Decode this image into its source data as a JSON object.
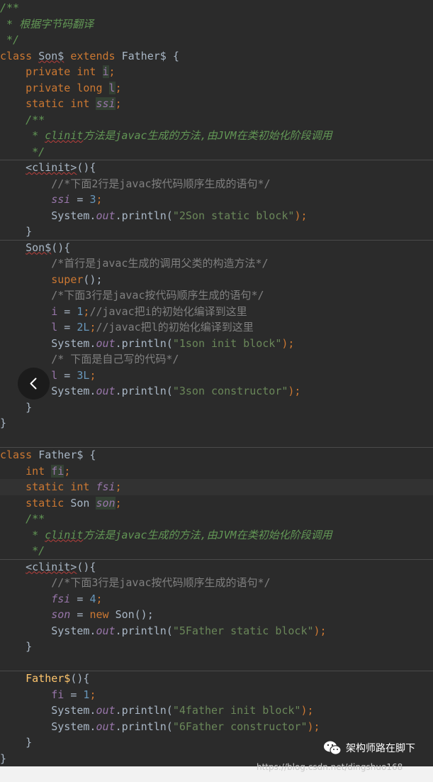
{
  "editor": {
    "lines": [
      [
        {
          "t": "/**",
          "c": "cmi"
        }
      ],
      [
        {
          "t": " * 根据字节码翻译",
          "c": "cmi"
        }
      ],
      [
        {
          "t": " */",
          "c": "cmi"
        }
      ],
      [
        {
          "t": "class ",
          "c": "kw"
        },
        {
          "t": "Son$",
          "c": "pl squig"
        },
        {
          "t": " extends ",
          "c": "kw"
        },
        {
          "t": "Father$ {",
          "c": "pl"
        }
      ],
      [
        {
          "t": "    private int ",
          "c": "kw"
        },
        {
          "t": "i",
          "c": "fd usage"
        },
        {
          "t": ";",
          "c": "kw"
        }
      ],
      [
        {
          "t": "    private long ",
          "c": "kw"
        },
        {
          "t": "l",
          "c": "fd usage"
        },
        {
          "t": ";",
          "c": "kw"
        }
      ],
      [
        {
          "t": "    static int ",
          "c": "kw"
        },
        {
          "t": "ssi",
          "c": "sf usage"
        },
        {
          "t": ";",
          "c": "kw"
        }
      ],
      [
        {
          "t": "    /**",
          "c": "cmi"
        }
      ],
      [
        {
          "t": "     * ",
          "c": "cmi"
        },
        {
          "t": "clinit",
          "c": "cmi squig"
        },
        {
          "t": "方法是javac生成的方法,由JVM在类初始化阶段调用",
          "c": "cmi"
        }
      ],
      [
        {
          "t": "     */",
          "c": "cmi"
        }
      ],
      [
        {
          "t": "    ",
          "c": "pl"
        },
        {
          "t": "<clinit>",
          "c": "pl squig"
        },
        {
          "t": "(){",
          "c": "pl"
        }
      ],
      [
        {
          "t": "        //*下面2行是javac按代码顺序生成的语句*/",
          "c": "cm"
        }
      ],
      [
        {
          "t": "        ",
          "c": "pl"
        },
        {
          "t": "ssi",
          "c": "sf"
        },
        {
          "t": " = ",
          "c": "pl"
        },
        {
          "t": "3",
          "c": "num"
        },
        {
          "t": ";",
          "c": "kw"
        }
      ],
      [
        {
          "t": "        System.",
          "c": "pl"
        },
        {
          "t": "out",
          "c": "sf"
        },
        {
          "t": ".println(",
          "c": "pl"
        },
        {
          "t": "\"2Son static block\"",
          "c": "str"
        },
        {
          "t": ");",
          "c": "kw"
        }
      ],
      [
        {
          "t": "    }",
          "c": "pl"
        }
      ],
      [
        {
          "t": "    ",
          "c": "pl"
        },
        {
          "t": "Son$",
          "c": "pl squig"
        },
        {
          "t": "(){",
          "c": "pl"
        }
      ],
      [
        {
          "t": "        /*首行是javac生成的调用父类的构造方法*/",
          "c": "cm"
        }
      ],
      [
        {
          "t": "        super",
          "c": "kw"
        },
        {
          "t": "();",
          "c": "pl"
        }
      ],
      [
        {
          "t": "        /*下面3行是javac按代码顺序生成的语句*/",
          "c": "cm"
        }
      ],
      [
        {
          "t": "        ",
          "c": "pl"
        },
        {
          "t": "i",
          "c": "fd"
        },
        {
          "t": " = ",
          "c": "pl"
        },
        {
          "t": "1",
          "c": "num"
        },
        {
          "t": ";",
          "c": "kw"
        },
        {
          "t": "//javac把i的初始化编译到这里",
          "c": "cm"
        }
      ],
      [
        {
          "t": "        ",
          "c": "pl"
        },
        {
          "t": "l",
          "c": "fd"
        },
        {
          "t": " = ",
          "c": "pl"
        },
        {
          "t": "2L",
          "c": "num"
        },
        {
          "t": ";",
          "c": "kw"
        },
        {
          "t": "//javac把l的初始化编译到这里",
          "c": "cm"
        }
      ],
      [
        {
          "t": "        System.",
          "c": "pl"
        },
        {
          "t": "out",
          "c": "sf"
        },
        {
          "t": ".println(",
          "c": "pl"
        },
        {
          "t": "\"1son init block\"",
          "c": "str"
        },
        {
          "t": ");",
          "c": "kw"
        }
      ],
      [
        {
          "t": "        /* 下面是自己写的代码*/",
          "c": "cm"
        }
      ],
      [
        {
          "t": "        ",
          "c": "pl"
        },
        {
          "t": "l",
          "c": "fd"
        },
        {
          "t": " = ",
          "c": "pl"
        },
        {
          "t": "3L",
          "c": "num"
        },
        {
          "t": ";",
          "c": "kw"
        }
      ],
      [
        {
          "t": "        System.",
          "c": "pl"
        },
        {
          "t": "out",
          "c": "sf"
        },
        {
          "t": ".println(",
          "c": "pl"
        },
        {
          "t": "\"3son constructor\"",
          "c": "str"
        },
        {
          "t": ");",
          "c": "kw"
        }
      ],
      [
        {
          "t": "    }",
          "c": "pl"
        }
      ],
      [
        {
          "t": "}",
          "c": "pl"
        }
      ],
      [],
      [
        {
          "t": "class ",
          "c": "kw"
        },
        {
          "t": "Father$ {",
          "c": "pl"
        }
      ],
      [
        {
          "t": "    int ",
          "c": "kw"
        },
        {
          "t": "fi",
          "c": "fd usage"
        },
        {
          "t": ";",
          "c": "kw"
        }
      ],
      [
        {
          "t": "    static int ",
          "c": "kw"
        },
        {
          "t": "fsi",
          "c": "sf"
        },
        {
          "t": ";",
          "c": "kw"
        }
      ],
      [
        {
          "t": "    static ",
          "c": "kw"
        },
        {
          "t": "Son ",
          "c": "pl"
        },
        {
          "t": "son",
          "c": "sf usage"
        },
        {
          "t": ";",
          "c": "kw"
        }
      ],
      [
        {
          "t": "    /**",
          "c": "cmi"
        }
      ],
      [
        {
          "t": "     * ",
          "c": "cmi"
        },
        {
          "t": "clinit",
          "c": "cmi squig"
        },
        {
          "t": "方法是javac生成的方法,由JVM在类初始化阶段调用",
          "c": "cmi"
        }
      ],
      [
        {
          "t": "     */",
          "c": "cmi"
        }
      ],
      [
        {
          "t": "    ",
          "c": "pl"
        },
        {
          "t": "<clinit>",
          "c": "pl squig"
        },
        {
          "t": "(){",
          "c": "pl"
        }
      ],
      [
        {
          "t": "        //*下面3行是javac按代码顺序生成的语句*/",
          "c": "cm"
        }
      ],
      [
        {
          "t": "        ",
          "c": "pl"
        },
        {
          "t": "fsi",
          "c": "sf"
        },
        {
          "t": " = ",
          "c": "pl"
        },
        {
          "t": "4",
          "c": "num"
        },
        {
          "t": ";",
          "c": "kw"
        }
      ],
      [
        {
          "t": "        ",
          "c": "pl"
        },
        {
          "t": "son",
          "c": "sf"
        },
        {
          "t": " = ",
          "c": "pl"
        },
        {
          "t": "new ",
          "c": "kw"
        },
        {
          "t": "Son();",
          "c": "pl"
        }
      ],
      [
        {
          "t": "        System.",
          "c": "pl"
        },
        {
          "t": "out",
          "c": "sf"
        },
        {
          "t": ".println(",
          "c": "pl"
        },
        {
          "t": "\"5Father static block\"",
          "c": "str"
        },
        {
          "t": ");",
          "c": "kw"
        }
      ],
      [
        {
          "t": "    }",
          "c": "pl"
        }
      ],
      [],
      [
        {
          "t": "    ",
          "c": "pl"
        },
        {
          "t": "Father$",
          "c": "fn"
        },
        {
          "t": "(){",
          "c": "pl"
        }
      ],
      [
        {
          "t": "        ",
          "c": "pl"
        },
        {
          "t": "fi",
          "c": "fd"
        },
        {
          "t": " = ",
          "c": "pl"
        },
        {
          "t": "1",
          "c": "num"
        },
        {
          "t": ";",
          "c": "kw"
        }
      ],
      [
        {
          "t": "        System.",
          "c": "pl"
        },
        {
          "t": "out",
          "c": "sf"
        },
        {
          "t": ".println(",
          "c": "pl"
        },
        {
          "t": "\"4father init block\"",
          "c": "str"
        },
        {
          "t": ");",
          "c": "kw"
        }
      ],
      [
        {
          "t": "        System.",
          "c": "pl"
        },
        {
          "t": "out",
          "c": "sf"
        },
        {
          "t": ".println(",
          "c": "pl"
        },
        {
          "t": "\"6Father constructor\"",
          "c": "str"
        },
        {
          "t": ");",
          "c": "kw"
        }
      ],
      [
        {
          "t": "    }",
          "c": "pl"
        }
      ],
      [
        {
          "t": "}",
          "c": "pl"
        }
      ]
    ]
  },
  "watermark": {
    "icon": "wechat-icon",
    "label": "架构师路在脚下"
  },
  "footer": {
    "url": "https://blog.csdn.net/dingshuo168"
  },
  "back_button": {
    "icon": "chevron-left-icon"
  },
  "colors": {
    "background": "#2b2b2b",
    "keyword": "#cc7832",
    "string": "#6a8759",
    "number": "#6897bb",
    "field": "#9876aa",
    "doc_comment": "#629755",
    "comment": "#808080",
    "method": "#ffc66d"
  }
}
